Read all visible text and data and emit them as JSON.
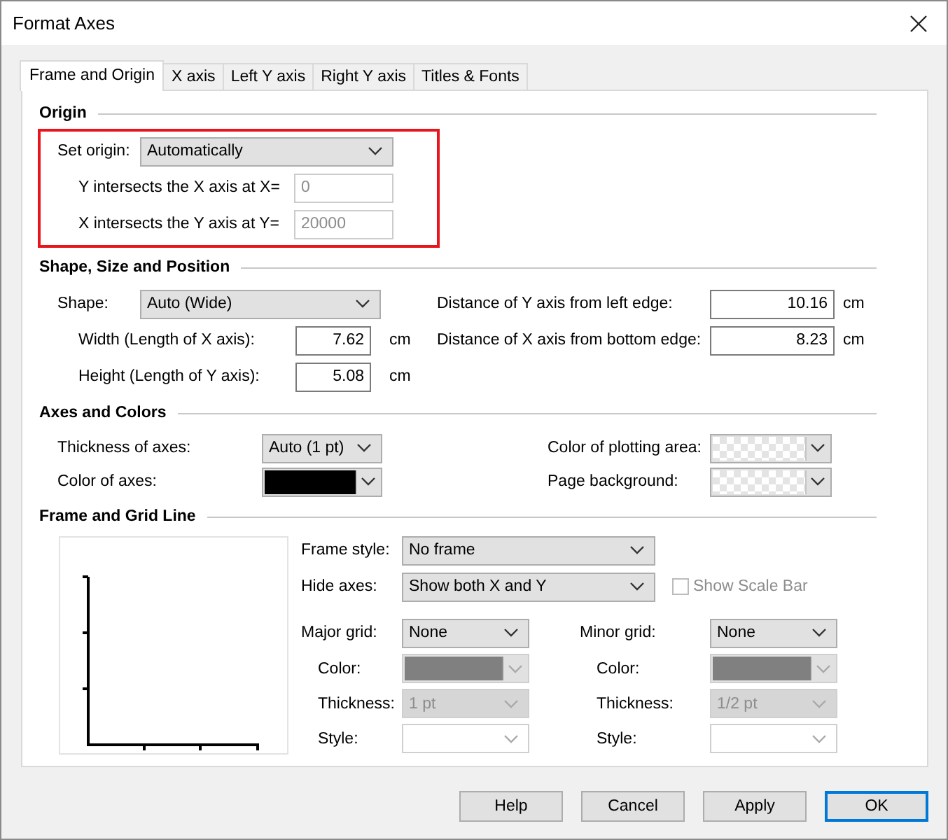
{
  "window": {
    "title": "Format Axes"
  },
  "tabs": [
    {
      "label": "Frame and Origin",
      "selected": true
    },
    {
      "label": "X axis",
      "selected": false
    },
    {
      "label": "Left Y axis",
      "selected": false
    },
    {
      "label": "Right Y axis",
      "selected": false
    },
    {
      "label": "Titles & Fonts",
      "selected": false
    }
  ],
  "origin": {
    "heading": "Origin",
    "highlighted": true,
    "set_origin": {
      "label": "Set origin:",
      "control": {
        "kind": "select",
        "value": "Automatically",
        "disabled": false
      }
    },
    "y_intersect": {
      "label": "Y intersects the X axis at X=",
      "control": {
        "kind": "text",
        "value": "0",
        "disabled": true
      }
    },
    "x_intersect": {
      "label": "X intersects the Y axis at Y=",
      "control": {
        "kind": "text",
        "value": "20000",
        "disabled": true
      }
    }
  },
  "shape": {
    "heading": "Shape, Size and Position",
    "shape": {
      "label": "Shape:",
      "control": {
        "kind": "select",
        "value": "Auto (Wide)",
        "disabled": false
      }
    },
    "width": {
      "label": "Width (Length of X axis):",
      "control": {
        "kind": "number",
        "value": "7.62",
        "disabled": false
      },
      "unit": "cm"
    },
    "height": {
      "label": "Height (Length of Y axis):",
      "control": {
        "kind": "number",
        "value": "5.08",
        "disabled": false
      },
      "unit": "cm"
    },
    "y_distance": {
      "label": "Distance of Y axis from left edge:",
      "control": {
        "kind": "number",
        "value": "10.16",
        "disabled": false
      },
      "unit": "cm"
    },
    "x_distance": {
      "label": "Distance of X axis from bottom edge:",
      "control": {
        "kind": "number",
        "value": "8.23",
        "disabled": false
      },
      "unit": "cm"
    }
  },
  "axes": {
    "heading": "Axes and Colors",
    "thickness": {
      "label": "Thickness of axes:",
      "control": {
        "kind": "select",
        "value": "Auto (1 pt)",
        "disabled": false
      }
    },
    "color": {
      "label": "Color of axes:",
      "control": {
        "kind": "swatch",
        "color": "#000000",
        "disabled": false
      }
    },
    "plot_color": {
      "label": "Color of plotting area:",
      "control": {
        "kind": "swatch",
        "transparent": true,
        "disabled": false
      }
    },
    "page_background": {
      "label": "Page background:",
      "control": {
        "kind": "swatch",
        "transparent": true,
        "disabled": false
      }
    }
  },
  "frame": {
    "heading": "Frame and Grid Line",
    "frame_style": {
      "label": "Frame style:",
      "control": {
        "kind": "select",
        "value": "No frame",
        "disabled": false
      }
    },
    "hide_axes": {
      "label": "Hide axes:",
      "control": {
        "kind": "select",
        "value": "Show both X and Y",
        "disabled": false
      }
    },
    "show_scale_bar": {
      "label": "Show Scale Bar",
      "checked": false,
      "disabled": true
    },
    "major": {
      "grid": {
        "label": "Major grid:",
        "control": {
          "kind": "select",
          "value": "None",
          "disabled": false
        }
      },
      "color": {
        "label": "Color:",
        "control": {
          "kind": "swatch",
          "color": "#808080",
          "disabled": true
        }
      },
      "thickness": {
        "label": "Thickness:",
        "control": {
          "kind": "select",
          "value": "1 pt",
          "disabled": true
        }
      },
      "style": {
        "label": "Style:",
        "control": {
          "kind": "select",
          "disabled": true
        }
      }
    },
    "minor": {
      "grid": {
        "label": "Minor grid:",
        "control": {
          "kind": "select",
          "value": "None",
          "disabled": false
        }
      },
      "color": {
        "label": "Color:",
        "control": {
          "kind": "swatch",
          "color": "#808080",
          "disabled": true
        }
      },
      "thickness": {
        "label": "Thickness:",
        "control": {
          "kind": "select",
          "value": "1/2 pt",
          "disabled": true
        }
      },
      "style": {
        "label": "Style:",
        "control": {
          "kind": "select",
          "disabled": true
        }
      }
    }
  },
  "buttons": [
    {
      "label": "Help",
      "default": false
    },
    {
      "label": "Cancel",
      "default": false
    },
    {
      "label": "Apply",
      "default": false
    },
    {
      "label": "OK",
      "default": true
    }
  ]
}
